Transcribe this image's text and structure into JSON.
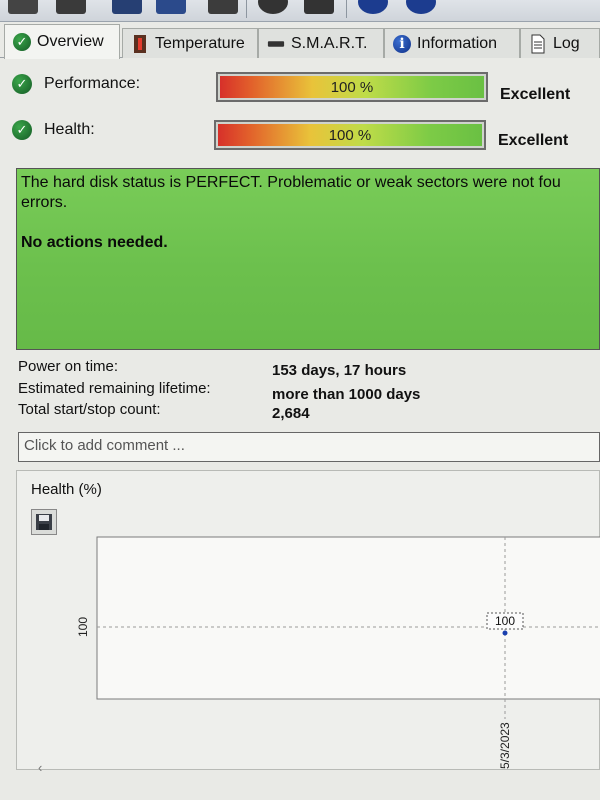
{
  "colors": {
    "status_green": "#6cc04d",
    "bar_red": "#d7302a",
    "bar_green": "#6ac043",
    "ok_icon": "#1f7a33",
    "info_icon": "#1a3f9e"
  },
  "tabs": [
    {
      "label": "Overview",
      "icon": "check-circle-icon",
      "active": true
    },
    {
      "label": "Temperature",
      "icon": "thermometer-icon",
      "active": false
    },
    {
      "label": "S.M.A.R.T.",
      "icon": "disk-drive-icon",
      "active": false
    },
    {
      "label": "Information",
      "icon": "info-icon",
      "active": false
    },
    {
      "label": "Log",
      "icon": "log-icon",
      "active": false
    }
  ],
  "performance": {
    "label": "Performance:",
    "percent": 100,
    "value_text": "100 %",
    "rating": "Excellent"
  },
  "health": {
    "label": "Health:",
    "percent": 100,
    "value_text": "100 %",
    "rating": "Excellent"
  },
  "status": {
    "line1": "The hard disk status is PERFECT. Problematic or weak sectors were not fou",
    "line2": "errors.",
    "line3": "No actions needed."
  },
  "info": {
    "power_on_label": "Power on time:",
    "power_on_value": "153 days, 17 hours",
    "lifetime_label": "Estimated remaining lifetime:",
    "lifetime_value": "more than 1000 days",
    "startstop_label": "Total start/stop count:",
    "startstop_value": "2,684"
  },
  "comment": {
    "placeholder": "Click to add comment ..."
  },
  "chart": {
    "title": "Health (%)",
    "save_icon": "floppy-disk-icon"
  },
  "chart_data": {
    "type": "line",
    "title": "Health (%)",
    "x": [
      "5/3/2023"
    ],
    "series": [
      {
        "values": [
          100
        ]
      }
    ],
    "y_ticks": [
      "100"
    ],
    "data_labels": [
      "100"
    ],
    "grid": "dashed crosshair at point"
  },
  "scroll": {
    "left_arrow": "‹"
  }
}
